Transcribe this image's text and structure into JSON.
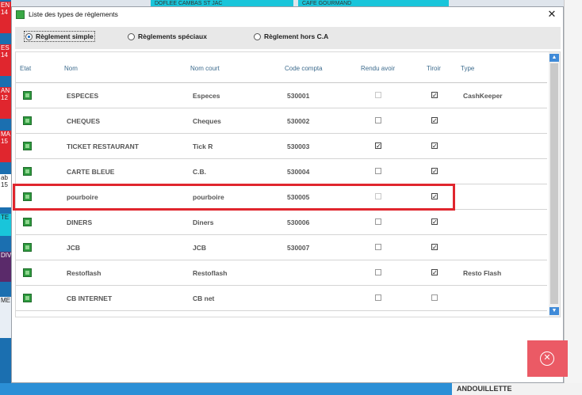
{
  "background": {
    "top_tiles": [
      "DOFLEE CAMBAS ST JAC",
      "CAFE GOURMAND"
    ],
    "left_tiles": [
      "EN 14",
      "ES 14",
      "AN 12",
      "MA 15",
      "ab 15",
      "TE",
      "DIV",
      "ME"
    ],
    "bottom_label": "ANDOUILLETTE"
  },
  "dialog": {
    "title": "Liste des types de règlements",
    "close_symbol": "✕"
  },
  "radios": [
    {
      "label": "Règlement simple",
      "selected": true
    },
    {
      "label": "Règlements spéciaux",
      "selected": false
    },
    {
      "label": "Règlement hors C.A",
      "selected": false
    }
  ],
  "columns": {
    "etat": "Etat",
    "nom": "Nom",
    "nom_court": "Nom court",
    "code_compta": "Code compta",
    "rendu_avoir": "Rendu avoir",
    "tiroir": "Tiroir",
    "type": "Type"
  },
  "rows": [
    {
      "nom": "ESPECES",
      "nom_court": "Especes",
      "code": "530001",
      "rendu_avoir": false,
      "rendu_disabled": true,
      "tiroir": true,
      "type": "CashKeeper"
    },
    {
      "nom": "CHEQUES",
      "nom_court": "Cheques",
      "code": "530002",
      "rendu_avoir": false,
      "rendu_disabled": false,
      "tiroir": true,
      "type": ""
    },
    {
      "nom": "TICKET RESTAURANT",
      "nom_court": "Tick R",
      "code": "530003",
      "rendu_avoir": true,
      "rendu_disabled": false,
      "tiroir": true,
      "type": ""
    },
    {
      "nom": "CARTE BLEUE",
      "nom_court": "C.B.",
      "code": "530004",
      "rendu_avoir": false,
      "rendu_disabled": false,
      "tiroir": true,
      "type": ""
    },
    {
      "nom": "pourboire",
      "nom_court": "pourboire",
      "code": "530005",
      "rendu_avoir": false,
      "rendu_disabled": true,
      "tiroir": true,
      "type": ""
    },
    {
      "nom": "DINERS",
      "nom_court": "Diners",
      "code": "530006",
      "rendu_avoir": false,
      "rendu_disabled": false,
      "tiroir": true,
      "type": ""
    },
    {
      "nom": "JCB",
      "nom_court": "JCB",
      "code": "530007",
      "rendu_avoir": false,
      "rendu_disabled": false,
      "tiroir": true,
      "type": ""
    },
    {
      "nom": "Restoflash",
      "nom_court": "Restoflash",
      "code": "",
      "rendu_avoir": false,
      "rendu_disabled": false,
      "tiroir": true,
      "type": "Resto Flash"
    },
    {
      "nom": "CB INTERNET",
      "nom_court": "CB net",
      "code": "",
      "rendu_avoir": false,
      "rendu_disabled": false,
      "tiroir": false,
      "type": ""
    }
  ],
  "scroll": {
    "up_symbol": "▲",
    "down_symbol": "▼"
  },
  "close_button_symbol": "✕",
  "colors": {
    "accent": "#3f8ad8",
    "highlight": "#e0262e",
    "close_button": "#eb5a65",
    "row_icon": "#2e9a3e"
  }
}
